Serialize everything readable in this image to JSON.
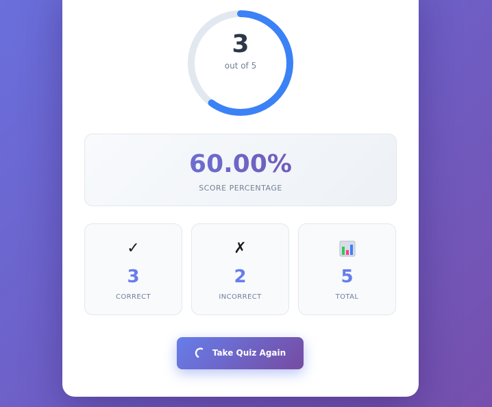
{
  "result": {
    "score": "3",
    "out_of": "out of 5",
    "fraction": 0.6
  },
  "percentage": {
    "value": "60.00%",
    "label": "SCORE PERCENTAGE"
  },
  "stats": [
    {
      "icon": "check-icon",
      "glyph": "✓",
      "value": "3",
      "label": "CORRECT"
    },
    {
      "icon": "cross-icon",
      "glyph": "✗",
      "value": "2",
      "label": "INCORRECT"
    },
    {
      "icon": "bar-chart-icon",
      "glyph": "",
      "value": "5",
      "label": "TOTAL"
    }
  ],
  "actions": {
    "retry_label": "Take Quiz Again",
    "retry_icon": "loading-spinner-icon"
  },
  "colors": {
    "ring_progress": "#3b82f6",
    "ring_track": "#e2e8f0",
    "accent_start": "#667eea",
    "accent_end": "#764ba2"
  }
}
